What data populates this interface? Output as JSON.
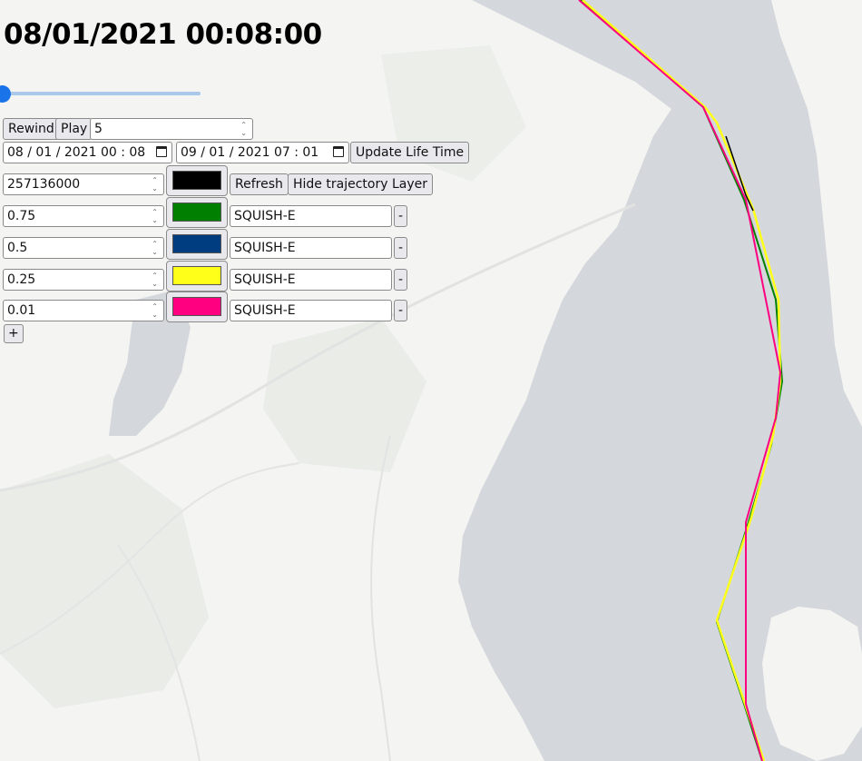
{
  "timestamp": "08/01/2021 00:08:00",
  "slider": {
    "position_fraction": 0.0
  },
  "controls": {
    "rewind_label": "Rewind",
    "play_label": "Play",
    "speed_value": "5",
    "start_date": "08 / 01 / 2021   00 : 08",
    "end_date": "09 / 01 / 2021   07 : 01",
    "update_label": "Update Life Time",
    "mmsi_value": "257136000",
    "mmsi_color": "#000000",
    "refresh_label": "Refresh",
    "hide_label": "Hide trajectory Layer",
    "add_label": "+"
  },
  "layers": [
    {
      "value": "0.75",
      "color": "#007f00",
      "algorithm": "SQUISH-E",
      "remove_label": "-"
    },
    {
      "value": "0.5",
      "color": "#003c80",
      "algorithm": "SQUISH-E",
      "remove_label": "-"
    },
    {
      "value": "0.25",
      "color": "#ffff1a",
      "algorithm": "SQUISH-E",
      "remove_label": "-"
    },
    {
      "value": "0.01",
      "color": "#ff0080",
      "algorithm": "SQUISH-E",
      "remove_label": "-"
    }
  ],
  "map": {
    "water_color": "#d4d8dc",
    "land_color": "#f4f4f2",
    "trajectory_colors": [
      "#000000",
      "#007f00",
      "#ffff1a",
      "#ff0080"
    ]
  }
}
